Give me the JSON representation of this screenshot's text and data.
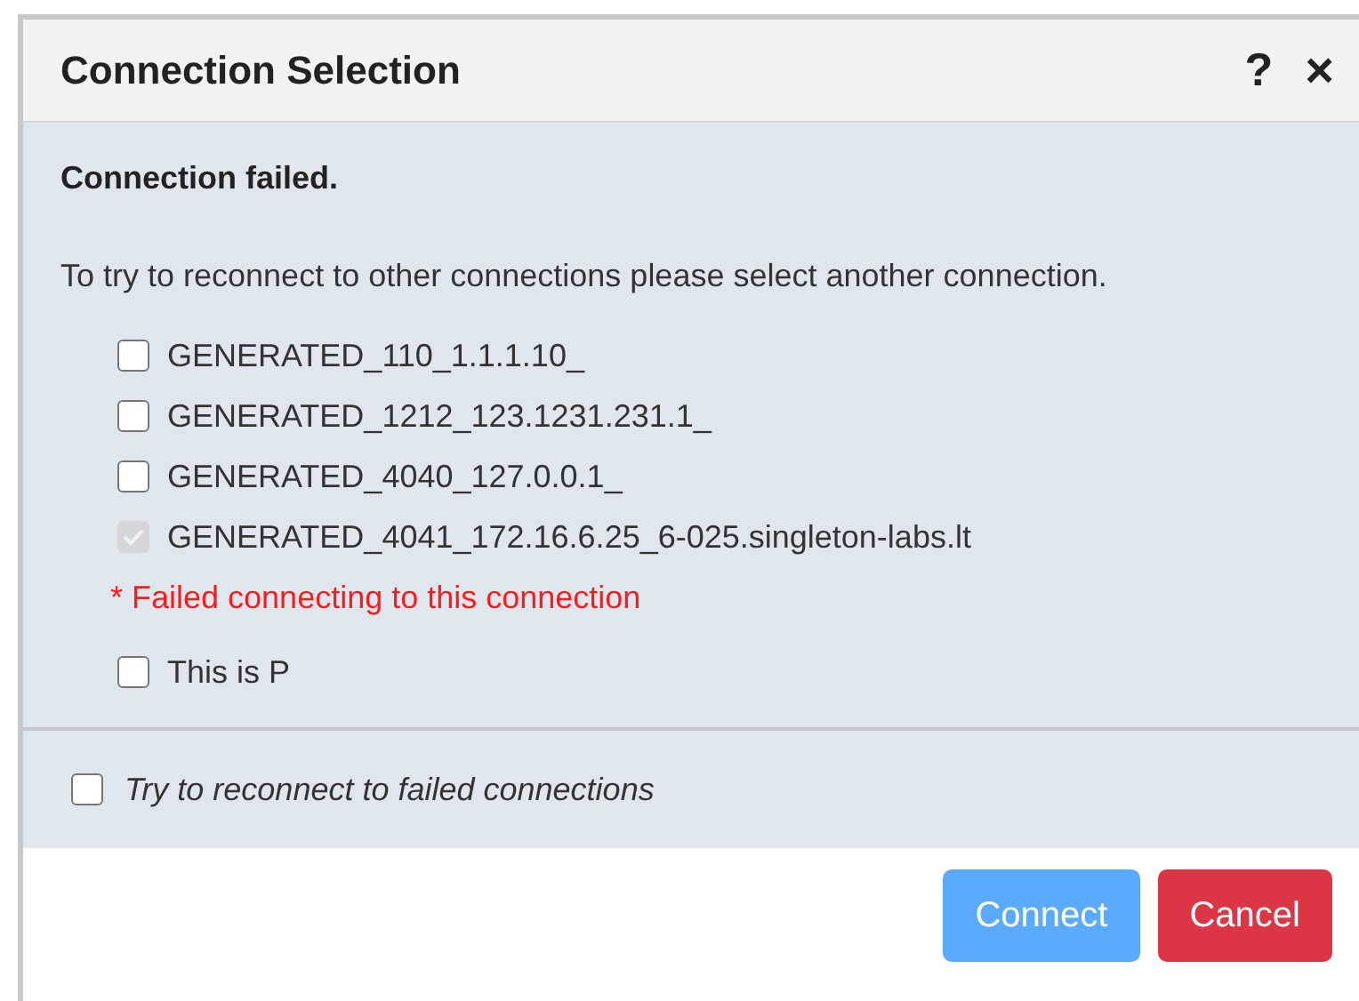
{
  "dialog": {
    "title": "Connection Selection",
    "help": "?",
    "close": "×"
  },
  "message": {
    "heading": "Connection failed.",
    "instruction": "To try to reconnect to other connections please select another connection."
  },
  "connections": [
    {
      "label": "GENERATED_110_1.1.1.10_",
      "checked": false,
      "disabled": false
    },
    {
      "label": "GENERATED_1212_123.1231.231.1_",
      "checked": false,
      "disabled": false
    },
    {
      "label": "GENERATED_4040_127.0.0.1_",
      "checked": false,
      "disabled": false
    },
    {
      "label": "GENERATED_4041_172.16.6.25_6-025.singleton-labs.lt",
      "checked": true,
      "disabled": true,
      "error": "* Failed connecting to this connection"
    },
    {
      "label": "This is P",
      "checked": false,
      "disabled": false
    }
  ],
  "retry_option": {
    "label": "Try to reconnect to failed connections",
    "checked": false
  },
  "buttons": [
    {
      "label": "Connect",
      "kind": "primary",
      "disabled": true
    },
    {
      "label": "Cancel",
      "kind": "danger",
      "disabled": false
    }
  ]
}
